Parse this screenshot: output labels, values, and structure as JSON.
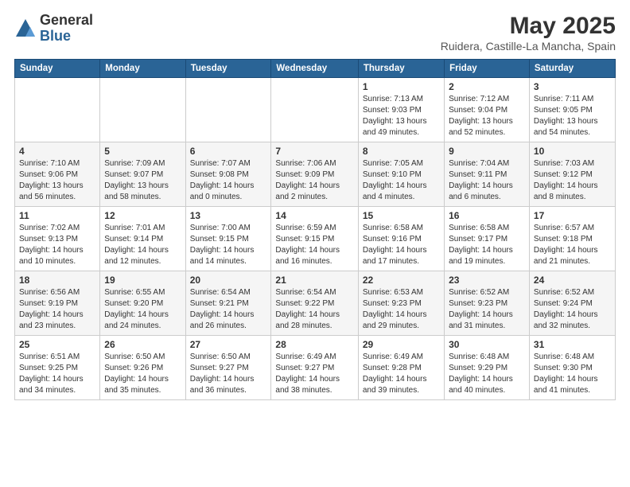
{
  "logo": {
    "general": "General",
    "blue": "Blue"
  },
  "title": "May 2025",
  "subtitle": "Ruidera, Castille-La Mancha, Spain",
  "days_of_week": [
    "Sunday",
    "Monday",
    "Tuesday",
    "Wednesday",
    "Thursday",
    "Friday",
    "Saturday"
  ],
  "weeks": [
    [
      {
        "day": "",
        "info": ""
      },
      {
        "day": "",
        "info": ""
      },
      {
        "day": "",
        "info": ""
      },
      {
        "day": "",
        "info": ""
      },
      {
        "day": "1",
        "info": "Sunrise: 7:13 AM\nSunset: 9:03 PM\nDaylight: 13 hours\nand 49 minutes."
      },
      {
        "day": "2",
        "info": "Sunrise: 7:12 AM\nSunset: 9:04 PM\nDaylight: 13 hours\nand 52 minutes."
      },
      {
        "day": "3",
        "info": "Sunrise: 7:11 AM\nSunset: 9:05 PM\nDaylight: 13 hours\nand 54 minutes."
      }
    ],
    [
      {
        "day": "4",
        "info": "Sunrise: 7:10 AM\nSunset: 9:06 PM\nDaylight: 13 hours\nand 56 minutes."
      },
      {
        "day": "5",
        "info": "Sunrise: 7:09 AM\nSunset: 9:07 PM\nDaylight: 13 hours\nand 58 minutes."
      },
      {
        "day": "6",
        "info": "Sunrise: 7:07 AM\nSunset: 9:08 PM\nDaylight: 14 hours\nand 0 minutes."
      },
      {
        "day": "7",
        "info": "Sunrise: 7:06 AM\nSunset: 9:09 PM\nDaylight: 14 hours\nand 2 minutes."
      },
      {
        "day": "8",
        "info": "Sunrise: 7:05 AM\nSunset: 9:10 PM\nDaylight: 14 hours\nand 4 minutes."
      },
      {
        "day": "9",
        "info": "Sunrise: 7:04 AM\nSunset: 9:11 PM\nDaylight: 14 hours\nand 6 minutes."
      },
      {
        "day": "10",
        "info": "Sunrise: 7:03 AM\nSunset: 9:12 PM\nDaylight: 14 hours\nand 8 minutes."
      }
    ],
    [
      {
        "day": "11",
        "info": "Sunrise: 7:02 AM\nSunset: 9:13 PM\nDaylight: 14 hours\nand 10 minutes."
      },
      {
        "day": "12",
        "info": "Sunrise: 7:01 AM\nSunset: 9:14 PM\nDaylight: 14 hours\nand 12 minutes."
      },
      {
        "day": "13",
        "info": "Sunrise: 7:00 AM\nSunset: 9:15 PM\nDaylight: 14 hours\nand 14 minutes."
      },
      {
        "day": "14",
        "info": "Sunrise: 6:59 AM\nSunset: 9:15 PM\nDaylight: 14 hours\nand 16 minutes."
      },
      {
        "day": "15",
        "info": "Sunrise: 6:58 AM\nSunset: 9:16 PM\nDaylight: 14 hours\nand 17 minutes."
      },
      {
        "day": "16",
        "info": "Sunrise: 6:58 AM\nSunset: 9:17 PM\nDaylight: 14 hours\nand 19 minutes."
      },
      {
        "day": "17",
        "info": "Sunrise: 6:57 AM\nSunset: 9:18 PM\nDaylight: 14 hours\nand 21 minutes."
      }
    ],
    [
      {
        "day": "18",
        "info": "Sunrise: 6:56 AM\nSunset: 9:19 PM\nDaylight: 14 hours\nand 23 minutes."
      },
      {
        "day": "19",
        "info": "Sunrise: 6:55 AM\nSunset: 9:20 PM\nDaylight: 14 hours\nand 24 minutes."
      },
      {
        "day": "20",
        "info": "Sunrise: 6:54 AM\nSunset: 9:21 PM\nDaylight: 14 hours\nand 26 minutes."
      },
      {
        "day": "21",
        "info": "Sunrise: 6:54 AM\nSunset: 9:22 PM\nDaylight: 14 hours\nand 28 minutes."
      },
      {
        "day": "22",
        "info": "Sunrise: 6:53 AM\nSunset: 9:23 PM\nDaylight: 14 hours\nand 29 minutes."
      },
      {
        "day": "23",
        "info": "Sunrise: 6:52 AM\nSunset: 9:23 PM\nDaylight: 14 hours\nand 31 minutes."
      },
      {
        "day": "24",
        "info": "Sunrise: 6:52 AM\nSunset: 9:24 PM\nDaylight: 14 hours\nand 32 minutes."
      }
    ],
    [
      {
        "day": "25",
        "info": "Sunrise: 6:51 AM\nSunset: 9:25 PM\nDaylight: 14 hours\nand 34 minutes."
      },
      {
        "day": "26",
        "info": "Sunrise: 6:50 AM\nSunset: 9:26 PM\nDaylight: 14 hours\nand 35 minutes."
      },
      {
        "day": "27",
        "info": "Sunrise: 6:50 AM\nSunset: 9:27 PM\nDaylight: 14 hours\nand 36 minutes."
      },
      {
        "day": "28",
        "info": "Sunrise: 6:49 AM\nSunset: 9:27 PM\nDaylight: 14 hours\nand 38 minutes."
      },
      {
        "day": "29",
        "info": "Sunrise: 6:49 AM\nSunset: 9:28 PM\nDaylight: 14 hours\nand 39 minutes."
      },
      {
        "day": "30",
        "info": "Sunrise: 6:48 AM\nSunset: 9:29 PM\nDaylight: 14 hours\nand 40 minutes."
      },
      {
        "day": "31",
        "info": "Sunrise: 6:48 AM\nSunset: 9:30 PM\nDaylight: 14 hours\nand 41 minutes."
      }
    ]
  ]
}
